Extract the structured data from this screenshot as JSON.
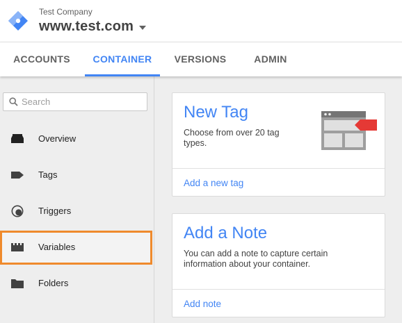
{
  "header": {
    "company": "Test Company",
    "domain": "www.test.com"
  },
  "tabs": [
    {
      "label": "ACCOUNTS"
    },
    {
      "label": "CONTAINER"
    },
    {
      "label": "VERSIONS"
    },
    {
      "label": "ADMIN"
    }
  ],
  "active_tab": "CONTAINER",
  "sidebar": {
    "search_placeholder": "Search",
    "items": [
      {
        "label": "Overview",
        "icon": "overview-icon"
      },
      {
        "label": "Tags",
        "icon": "tag-icon"
      },
      {
        "label": "Triggers",
        "icon": "triggers-icon"
      },
      {
        "label": "Variables",
        "icon": "variables-icon"
      },
      {
        "label": "Folders",
        "icon": "folder-icon"
      }
    ],
    "highlighted_item": "Variables"
  },
  "cards": {
    "new_tag": {
      "title": "New Tag",
      "description": "Choose from over 20 tag types.",
      "link": "Add a new tag"
    },
    "add_note": {
      "title": "Add a Note",
      "description": "You can add a note to capture certain information about your container.",
      "link": "Add note"
    }
  },
  "colors": {
    "accent": "#4285f4",
    "highlight": "#ef8a2c",
    "tag_red": "#e53935"
  }
}
